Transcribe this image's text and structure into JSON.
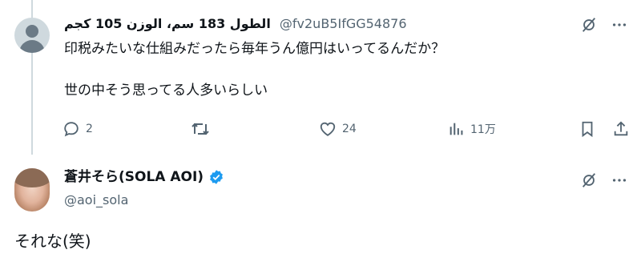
{
  "reply": {
    "display_name": "الطول 183 سم، الوزن 105 كجم",
    "handle": "@fv2uB5IfGG54876",
    "text_line1": "印税みたいな仕組みだったら毎年うん億円はいってるんだか？",
    "text_line2": "世の中そう思ってる人多いらしい",
    "replies_count": "2",
    "likes_count": "24",
    "views_count": "11万"
  },
  "main_post": {
    "display_name": "蒼井そら(SOLA AOI)",
    "handle": "@aoi_sola",
    "text": "それな(笑)"
  },
  "colors": {
    "text": "#0f1419",
    "secondary": "#536471",
    "verified": "#1d9bf0",
    "thread_line": "#cfd9de"
  }
}
